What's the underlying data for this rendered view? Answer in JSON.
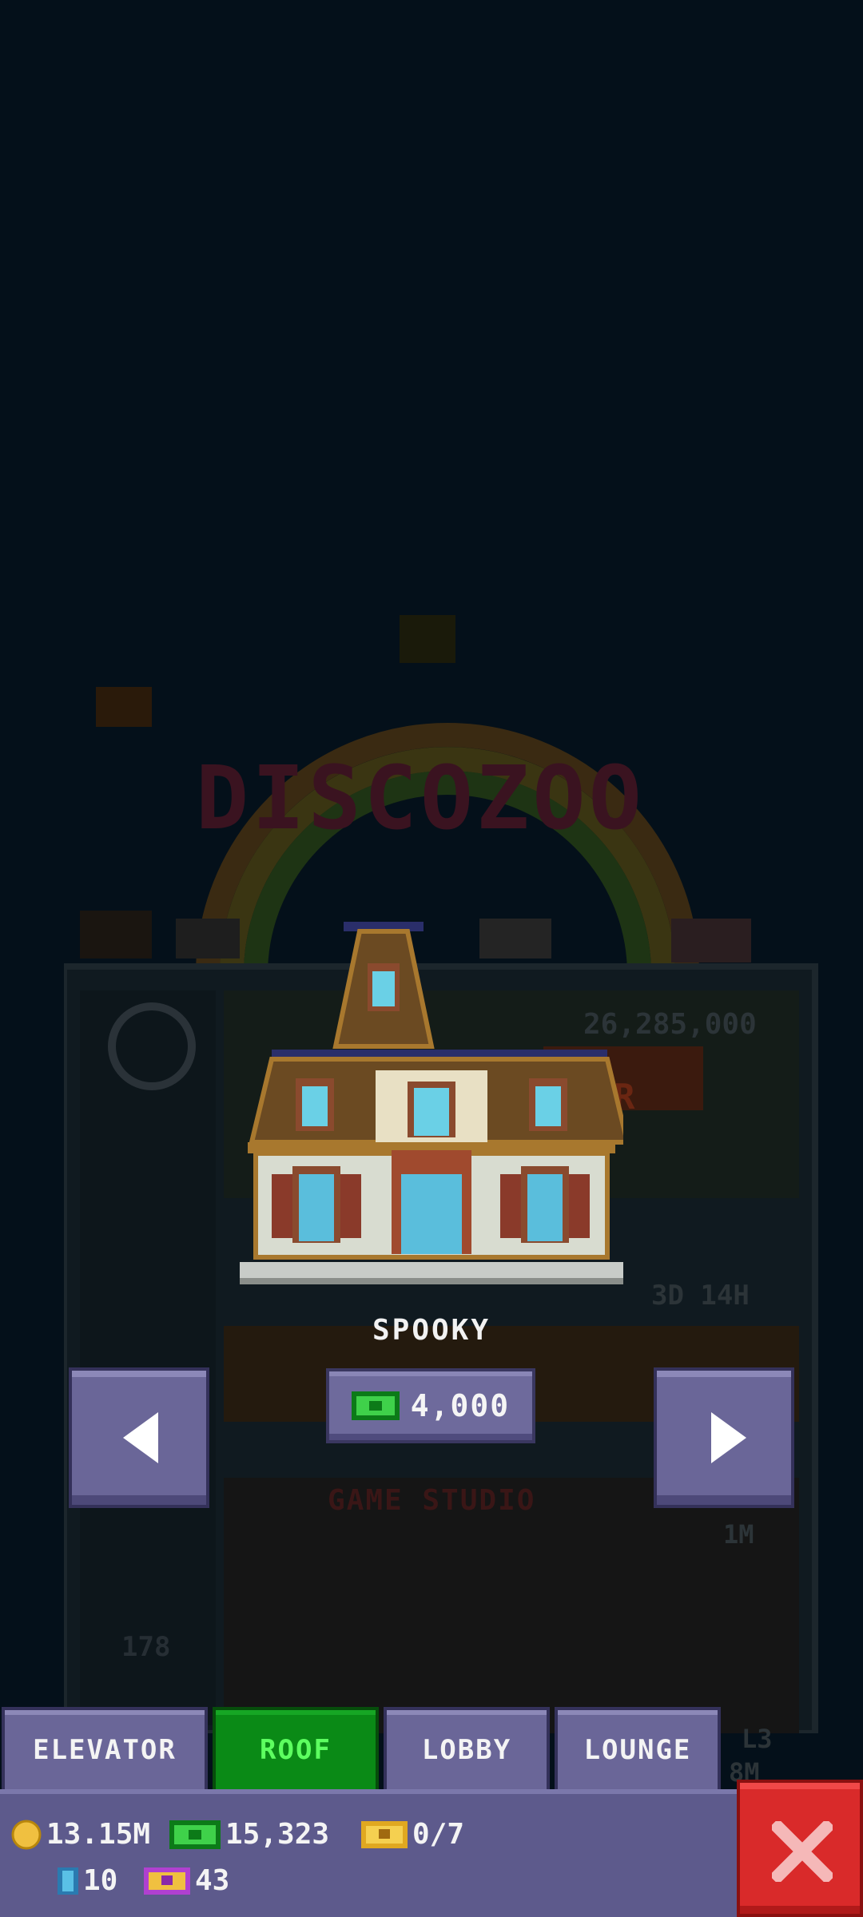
{
  "item": {
    "name": "SPOOKY",
    "price": "4,000",
    "price_currency": "bux"
  },
  "nav": {
    "prev_icon": "arrow-left-icon",
    "next_icon": "arrow-right-icon"
  },
  "background": {
    "logo_text": "DISCOZOO",
    "cost_text": "26,285,000",
    "floor_button": "OOR",
    "timer_text": "3D 14H",
    "floor_name": "GAME STUDIO",
    "floor_value": "1M",
    "floor_number": "178",
    "lobby_label": "L3",
    "lobby_value": "8M"
  },
  "tabs": [
    {
      "label": "ELEVATOR",
      "active": false
    },
    {
      "label": "ROOF",
      "active": true
    },
    {
      "label": "LOBBY",
      "active": false
    },
    {
      "label": "LOUNGE",
      "active": false
    }
  ],
  "stats": {
    "coins": "13.15M",
    "bux": "15,323",
    "tickets": "0/7",
    "blue_items": "10",
    "golden_tickets": "43"
  },
  "colors": {
    "accent": "#6a6698",
    "active_tab": "#0a8a16",
    "close": "#d92a2a",
    "background": "#04101a"
  }
}
